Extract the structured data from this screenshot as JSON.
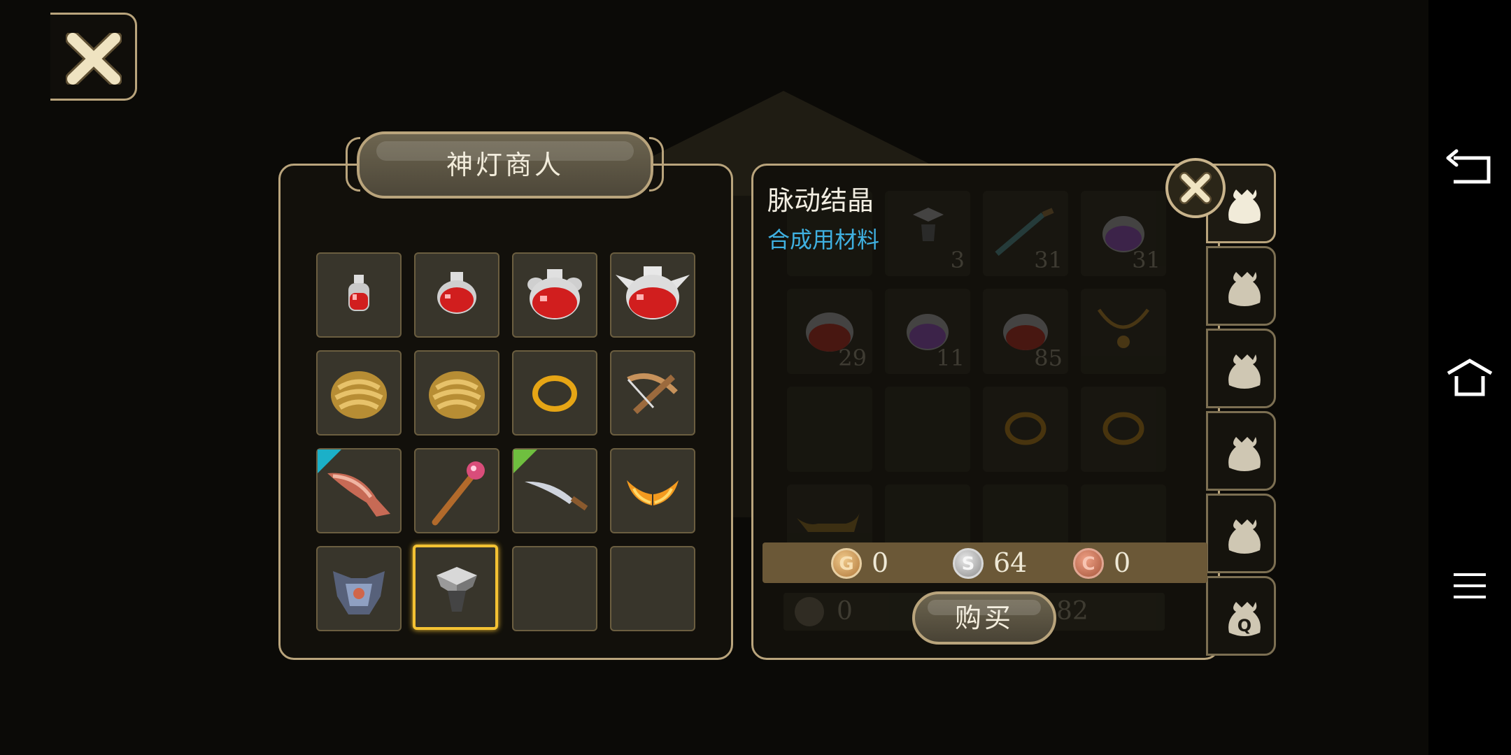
{
  "shop": {
    "title": "神灯商人",
    "items": [
      {
        "name": "small-red-potion"
      },
      {
        "name": "medium-red-potion"
      },
      {
        "name": "large-red-potion"
      },
      {
        "name": "winged-red-potion"
      },
      {
        "name": "gold-ore"
      },
      {
        "name": "gold-ore"
      },
      {
        "name": "gold-ring"
      },
      {
        "name": "crossbow"
      },
      {
        "name": "crimson-blade",
        "tag_color": "#1bb0c8"
      },
      {
        "name": "ruby-staff"
      },
      {
        "name": "curved-sword",
        "tag_color": "#6fbf3f"
      },
      {
        "name": "flame-wings"
      },
      {
        "name": "dark-armor"
      },
      {
        "name": "pulse-crystal",
        "selected": true
      },
      {
        "name": "empty"
      },
      {
        "name": "empty"
      }
    ]
  },
  "detail": {
    "item_name": "脉动结晶",
    "item_type": "合成用材料"
  },
  "inventory": {
    "counts": [
      "",
      "3",
      "31",
      "31",
      "29",
      "11",
      "85",
      "",
      "",
      "",
      "",
      "",
      "",
      "",
      "",
      ""
    ]
  },
  "price": {
    "gold_symbol": "G",
    "gold": "0",
    "silver_symbol": "S",
    "silver": "64",
    "copper_symbol": "C",
    "copper": "0"
  },
  "owned": {
    "gold": "0",
    "copper": "82"
  },
  "buy_label": "购买",
  "tab_q_label": "Q",
  "colors": {
    "frame": "#b9a47c",
    "selected": "#f4c233",
    "item_type_text": "#3fb0e0",
    "price_bar": "#6b5837"
  }
}
